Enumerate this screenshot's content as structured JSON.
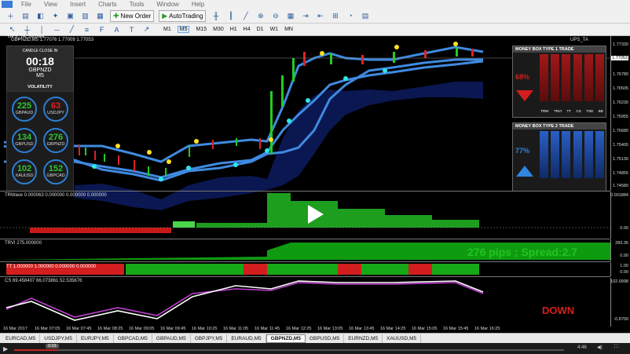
{
  "menu": {
    "items": [
      "File",
      "View",
      "Insert",
      "Charts",
      "Tools",
      "Window",
      "Help"
    ]
  },
  "toolbar": {
    "new_order": "New Order",
    "autotrading": "AutoTrading"
  },
  "timeframes": [
    "M1",
    "M5",
    "M15",
    "M30",
    "H1",
    "H4",
    "D1",
    "W1",
    "MN"
  ],
  "chart": {
    "symbol_header": "GBPNZD,M5  1.77076 1.77009 1.77053",
    "corner_label": "UPS_TA",
    "small_label": "UPS_TA_SIGNAL"
  },
  "candle_box": {
    "title": "CANDLE CLOSE IN",
    "time": "00:18",
    "pair": "GBPNZD",
    "tf": "M5"
  },
  "volatility": {
    "title": "VOLATILITY",
    "items": [
      {
        "value": "225",
        "pair": "GBPAUD",
        "color": "#2ec42e"
      },
      {
        "value": "63",
        "pair": "USDJPY",
        "color": "#e02020"
      },
      {
        "value": "134",
        "pair": "GBPUSD",
        "color": "#2ec42e"
      },
      {
        "value": "276",
        "pair": "GBPNZD",
        "color": "#2ec42e"
      },
      {
        "value": "102",
        "pair": "XAUUSD",
        "color": "#2ec42e"
      },
      {
        "value": "152",
        "pair": "GBPCAD",
        "color": "#2ec42e"
      }
    ]
  },
  "money_box_1": {
    "title": "MONEY BOX TYPE 1 TRADE",
    "pct": "68%",
    "labels": [
      "TRW",
      "TRVI",
      "TT",
      "CS",
      "TSD",
      "BB"
    ]
  },
  "money_box_2": {
    "title": "MONEY BOX TYPE 2 TRADE",
    "pct": "77%",
    "labels": [
      "TRW",
      "TRVI",
      "TT",
      "CS",
      "TSD",
      "BB"
    ]
  },
  "price_scale": [
    "1.77330",
    "1.77055",
    "1.76780",
    "1.76505",
    "1.76230",
    "1.75955",
    "1.75680",
    "1.75405",
    "1.75130",
    "1.74855",
    "1.74580"
  ],
  "price_highlight": "1.77053",
  "panels": {
    "trwave": {
      "title": "TRWave 0.000063 0.000000 0.000000 0.000000",
      "scale": [
        "0.001884",
        "0.00"
      ]
    },
    "trvi": {
      "title": "TRVI 275.000000",
      "scale": [
        "283.35",
        "0.00"
      ],
      "text": "276 pips ; Spread:2.7"
    },
    "tt": {
      "title": "TT 1.000000 1.000000 0.000000 0.000000",
      "scale": [
        "1.00",
        "0.00"
      ]
    },
    "cs": {
      "title": "CS 69.458407 66.073861 52.535676",
      "scale": [
        "102.0998",
        "-0.8700"
      ],
      "text": "DOWN"
    }
  },
  "time_axis": [
    "16 Mar 2017",
    "16 Mar 07:05",
    "16 Mar 07:45",
    "16 Mar 08:25",
    "16 Mar 09:05",
    "16 Mar 09:45",
    "16 Mar 10:25",
    "16 Mar 11:05",
    "16 Mar 11:45",
    "16 Mar 12:25",
    "16 Mar 13:05",
    "16 Mar 13:45",
    "16 Mar 14:25",
    "16 Mar 15:05",
    "16 Mar 15:45",
    "16 Mar 16:25"
  ],
  "tabs": [
    "EURCAD,M5",
    "USDJPY,M5",
    "EURJPY,M5",
    "GBPCAD,M5",
    "GBPAUD,M5",
    "GBPJPY,M5",
    "EURAUD,M5",
    "GBPNZD,M5",
    "GBPUSD,M5",
    "EURNZD,M5",
    "XAUUSD,M5"
  ],
  "active_tab": "GBPNZD,M5",
  "player": {
    "elapsed": "0:03",
    "duration": "4:46"
  }
}
